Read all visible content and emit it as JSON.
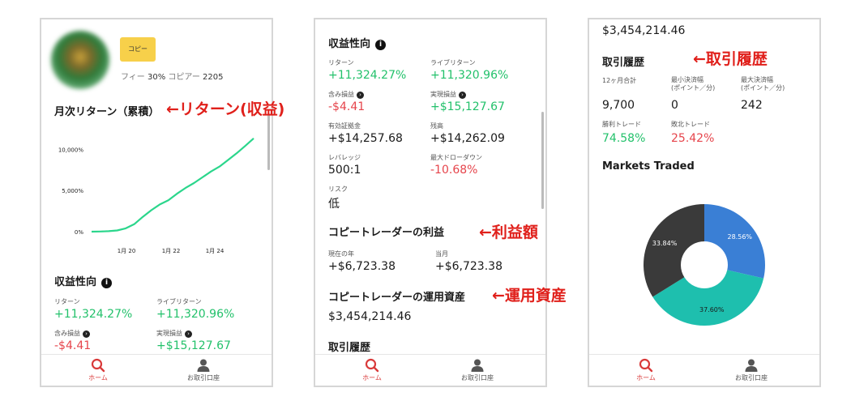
{
  "nav": {
    "home": "ホーム",
    "account": "お取引口座"
  },
  "annotations": {
    "returns": "←リターン(収益)",
    "profit": "←利益額",
    "aum": "←運用資産",
    "history": "←取引履歴"
  },
  "colors": {
    "green": "#23c16b",
    "red": "#e6454c",
    "copy_button": "#f7d04a",
    "line": "#2bd68c"
  },
  "screen1": {
    "copy_button": "コピー",
    "fee_label": "フィー",
    "fee_value": "30%",
    "copiers_label": "コピアー",
    "copiers_value": "2205",
    "monthly_return_title": "月次リターン（累積）",
    "profit_title": "収益性向",
    "return_label": "リターン",
    "return_value": "+11,324.27%",
    "live_return_label": "ライブリターン",
    "live_return_value": "+11,320.96%",
    "unrealized_label": "含み損益",
    "unrealized_value": "-$4.41",
    "realized_label": "実現損益",
    "realized_value": "+$15,127.67"
  },
  "chart_data": {
    "type": "line",
    "title": "月次リターン（累積）",
    "x_ticks": [
      "1月 20",
      "1月 22",
      "1月 24"
    ],
    "y_ticks": [
      "0%",
      "5,000%",
      "10,000%"
    ],
    "ylim": [
      0,
      11500
    ],
    "series": [
      {
        "values": [
          0,
          20,
          60,
          150,
          400,
          900,
          1800,
          2600,
          3300,
          3800,
          4600,
          5300,
          5900,
          6600,
          7300,
          7900,
          8700,
          9500,
          10400,
          11324
        ]
      }
    ]
  },
  "screen2": {
    "profit_title": "収益性向",
    "return_label": "リターン",
    "return_value": "+11,324.27%",
    "live_return_label": "ライブリターン",
    "live_return_value": "+11,320.96%",
    "unrealized_label": "含み損益",
    "unrealized_value": "-$4.41",
    "realized_label": "実現損益",
    "realized_value": "+$15,127.67",
    "margin_label": "有効証拠金",
    "margin_value": "+$14,257.68",
    "balance_label": "残高",
    "balance_value": "+$14,262.09",
    "leverage_label": "レバレッジ",
    "leverage_value": "500:1",
    "drawdown_label": "最大ドローダウン",
    "drawdown_value": "-10.68%",
    "risk_label": "リスク",
    "risk_value": "低",
    "copy_profit_title": "コピートレーダーの利益",
    "this_year_label": "現在の年",
    "this_year_value": "+$6,723.38",
    "this_month_label": "当月",
    "this_month_value": "+$6,723.38",
    "aum_title": "コピートレーダーの運用資産",
    "aum_value": "$3,454,214.46",
    "history_title": "取引履歴"
  },
  "screen3": {
    "aum_value": "$3,454,214.46",
    "history_title": "取引履歴",
    "total_12m_label": "12ヶ月合計",
    "total_12m_value": "9,700",
    "min_pips_label_1": "最小決済幅",
    "min_pips_label_2": "(ポイント／分)",
    "min_pips_value": "0",
    "max_pips_label_1": "最大決済幅",
    "max_pips_label_2": "(ポイント／分)",
    "max_pips_value": "242",
    "win_label": "勝利トレード",
    "win_value": "74.58%",
    "loss_label": "敗北トレード",
    "loss_value": "25.42%",
    "markets_title": "Markets Traded",
    "pie": [
      {
        "label": "28.56%",
        "value": 28.56,
        "color": "#3a7fd5"
      },
      {
        "label": "37.60%",
        "value": 37.6,
        "color": "#1ebfae"
      },
      {
        "label": "33.84%",
        "value": 33.84,
        "color": "#3a3a3a"
      }
    ]
  }
}
